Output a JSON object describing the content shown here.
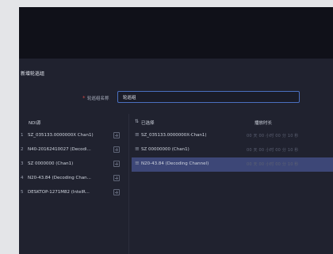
{
  "dialog": {
    "title": "新增轮巡组",
    "name_label": "轮巡组名称",
    "name_required_mark": "*",
    "name_value": "轮巡组"
  },
  "left_list": {
    "header": "NDI源",
    "items": [
      {
        "index": "1",
        "label": "SZ_035133.0000000X Chan1)"
      },
      {
        "index": "2",
        "label": "N40-20162410027 (Decodi..."
      },
      {
        "index": "3",
        "label": "SZ 0000000 (Chan1)"
      },
      {
        "index": "4",
        "label": "N20-43.84 (Decoding Chan..."
      },
      {
        "index": "5",
        "label": "DESKTOP-1271M82 (IntelR..."
      }
    ]
  },
  "right_list": {
    "sort_icon": "sort-icon",
    "header_selected": "已选择",
    "header_duration": "播放时长",
    "items": [
      {
        "label": "SZ_035133.0000000X-Chan1)",
        "time": "00 天 00 小时 00 分 10 秒",
        "selected": false
      },
      {
        "label": "SZ 00000000 (Chan1)",
        "time": "00 天 00 小时 00 分 10 秒",
        "selected": false
      },
      {
        "label": "N20-43.84 (Decoding Channel)",
        "time": "00 天 00 小时 00 分 10 秒",
        "selected": true
      }
    ]
  }
}
